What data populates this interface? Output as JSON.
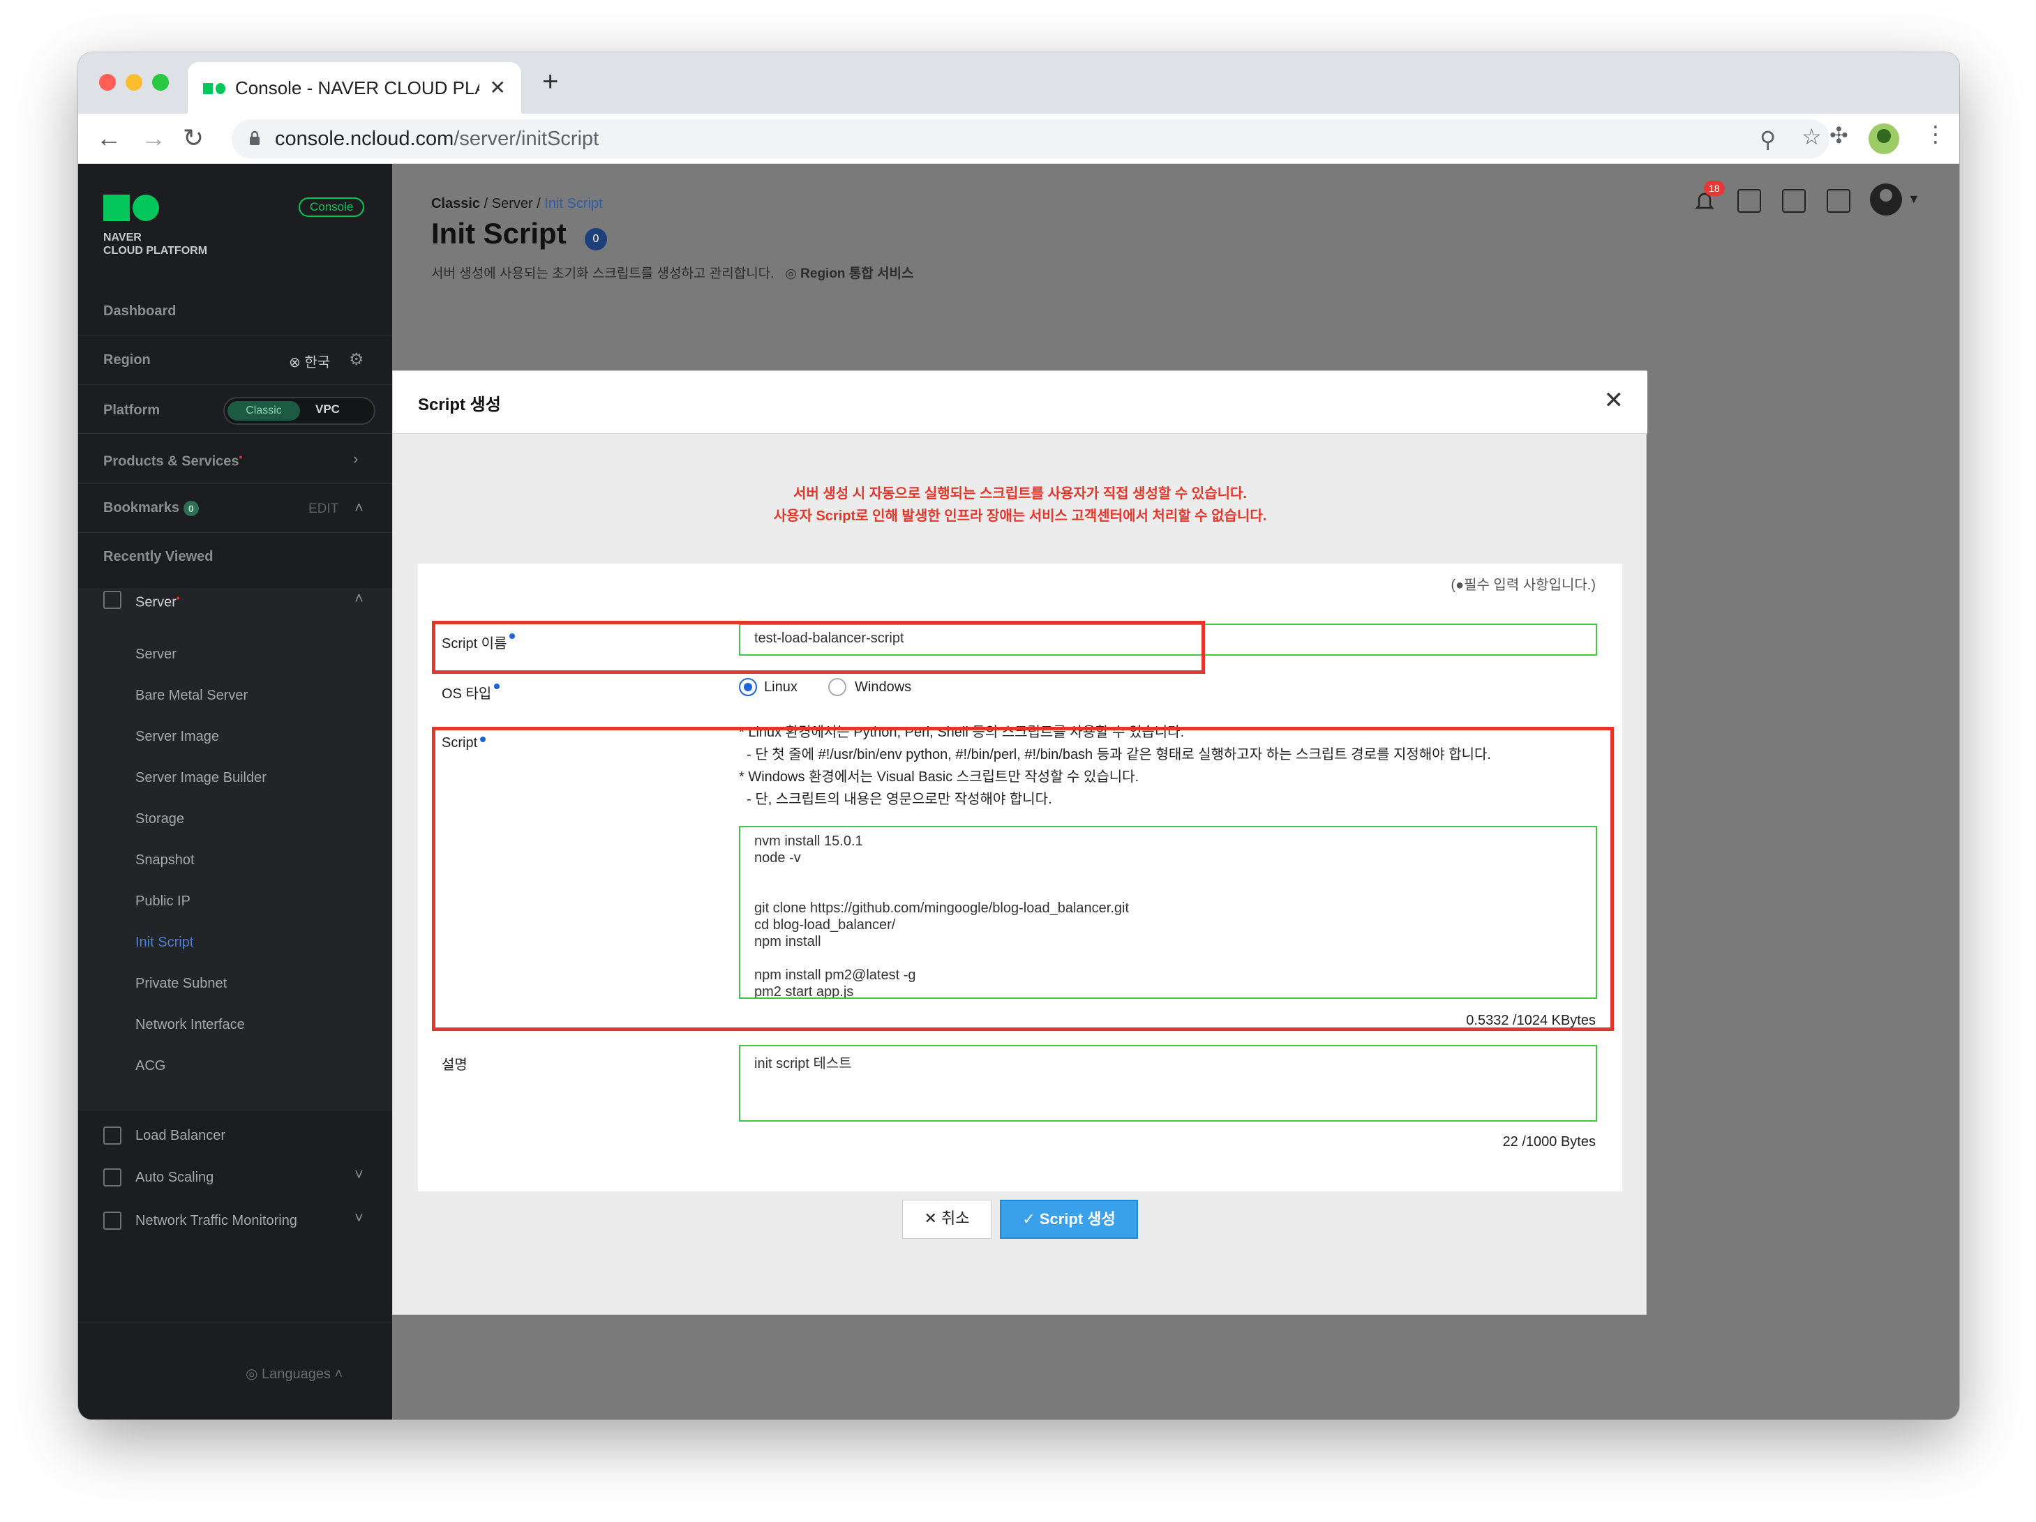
{
  "browser": {
    "tab_title": "Console - NAVER CLOUD PLAT",
    "tab_close": "✕",
    "new_tab": "+",
    "url_host": "console.ncloud.com",
    "url_path": "/server/initScript"
  },
  "sidebar": {
    "logo_line1": "NAVER",
    "logo_line2": "CLOUD PLATFORM",
    "console_badge": "Console",
    "dashboard": "Dashboard",
    "region_label": "Region",
    "region_value": "한국",
    "platform_label": "Platform",
    "platform_options": [
      "Classic",
      "VPC"
    ],
    "products": "Products & Services",
    "bookmarks": "Bookmarks",
    "bookmarks_count": "0",
    "bookmarks_edit": "EDIT",
    "recently_viewed": "Recently Viewed",
    "server_group": "Server",
    "server_items": [
      "Server",
      "Bare Metal Server",
      "Server Image",
      "Server Image Builder",
      "Storage",
      "Snapshot",
      "Public IP",
      "Init Script",
      "Private Subnet",
      "Network Interface",
      "ACG"
    ],
    "active_item": "Init Script",
    "other_groups": [
      "Load Balancer",
      "Auto Scaling",
      "Network Traffic Monitoring"
    ],
    "languages": "Languages"
  },
  "page": {
    "breadcrumb": [
      "Classic",
      "Server",
      "Init Script"
    ],
    "title": "Init Script",
    "title_badge": "0",
    "description": "서버 생성에 사용되는 초기화 스크립트를 생성하고 관리합니다.",
    "region_note": "Region 통합 서비스",
    "notification_count": "18"
  },
  "modal": {
    "title": "Script 생성",
    "close": "✕",
    "notice_line1": "서버 생성 시 자동으로 실행되는 스크립트를 사용자가 직접 생성할 수 있습니다.",
    "notice_line2": "사용자 Script로 인해 발생한 인프라 장애는 서비스 고객센터에서 처리할 수 없습니다.",
    "required_note": "(●필수 입력 사항입니다.)",
    "name_label": "Script 이름",
    "name_value": "test-load-balancer-script",
    "os_label": "OS 타입",
    "os_options": [
      "Linux",
      "Windows"
    ],
    "os_selected": "Linux",
    "script_label": "Script",
    "script_hints": [
      "* Linux 환경에서는 Python, Perl, Shell 등의 스크립트를 사용할 수 있습니다.",
      "  - 단 첫 줄에 #!/usr/bin/env python, #!/bin/perl, #!/bin/bash 등과 같은 형태로 실행하고자 하는 스크립트 경로를 지정해야 합니다.",
      "* Windows 환경에서는 Visual Basic 스크립트만 작성할 수 있습니다.",
      "  - 단, 스크립트의 내용은 영문으로만 작성해야 합니다."
    ],
    "script_content": "nvm install 15.0.1\nnode -v\n\n\ngit clone https://github.com/mingoogle/blog-load_balancer.git\ncd blog-load_balancer/\nnpm install\n\nnpm install pm2@latest -g\npm2 start app.js",
    "script_size": "0.5332 /1024 KBytes",
    "desc_label": "설명",
    "desc_value": "init script 테스트",
    "desc_size": "22 /1000 Bytes",
    "cancel_label": "✕ 취소",
    "create_label": "✓ Script 생성"
  },
  "colors": {
    "accent_green": "#03c75a",
    "highlight_red": "#e2372a",
    "primary_blue": "#3aa0e9"
  }
}
